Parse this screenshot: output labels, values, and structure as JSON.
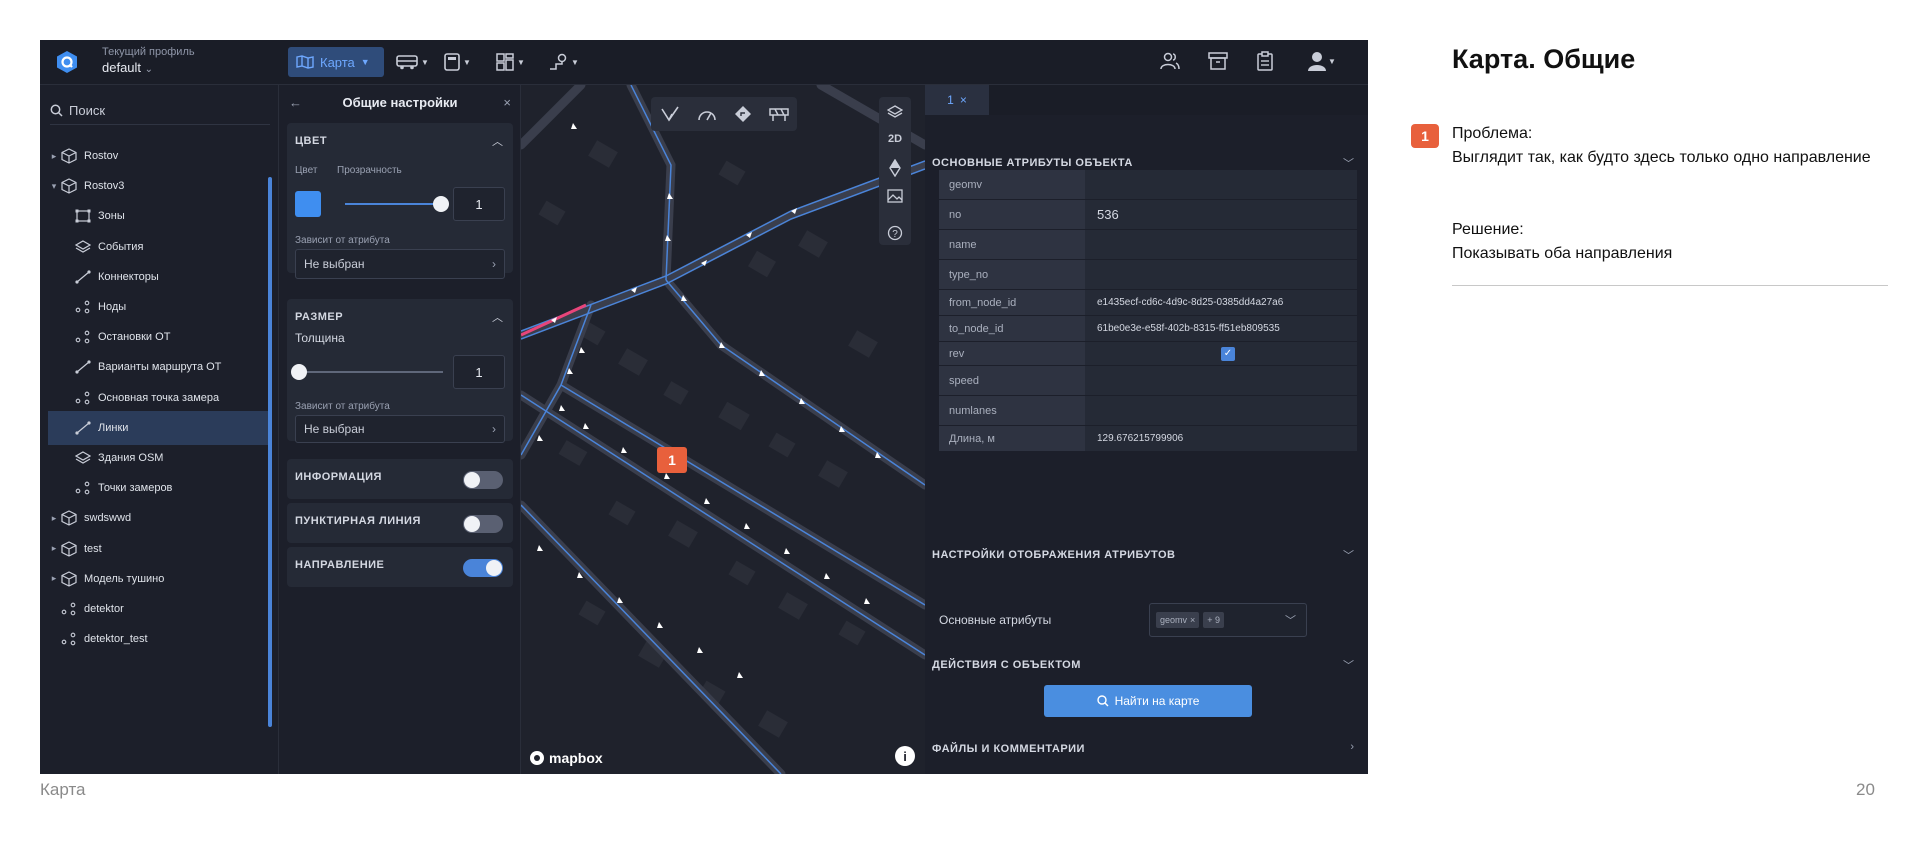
{
  "slide": {
    "title": "Карта. Общие",
    "badge": "1",
    "problem_label": "Проблема:",
    "problem_text": "Выглядит так, как будто здесь только одно направление",
    "solution_label": "Решение:",
    "solution_text": "Показывать оба направления",
    "footer_left": "Карта",
    "page_number": "20"
  },
  "topbar": {
    "profile_caption": "Текущий профиль",
    "profile_value": "default",
    "map_button": "Карта"
  },
  "sidebar": {
    "search_placeholder": "Поиск",
    "items": [
      {
        "label": "Rostov",
        "caret": "▸",
        "icon": "cube-icon"
      },
      {
        "label": "Rostov3",
        "caret": "▾",
        "icon": "cube-icon"
      },
      {
        "label": "Зоны",
        "icon": "zone-icon"
      },
      {
        "label": "События",
        "icon": "layers-icon"
      },
      {
        "label": "Коннекторы",
        "icon": "link-icon"
      },
      {
        "label": "Ноды",
        "icon": "nodes-icon"
      },
      {
        "label": "Остановки ОТ",
        "icon": "nodes-icon"
      },
      {
        "label": "Варианты маршрута ОТ",
        "icon": "link-icon"
      },
      {
        "label": "Основная точка замера",
        "icon": "nodes-icon"
      },
      {
        "label": "Линки",
        "icon": "link-icon",
        "active": true
      },
      {
        "label": "Здания OSM",
        "icon": "layers-icon"
      },
      {
        "label": "Точки замеров",
        "icon": "nodes-icon"
      },
      {
        "label": "swdswwd",
        "caret": "▸",
        "icon": "cube-icon"
      },
      {
        "label": "test",
        "caret": "▸",
        "icon": "cube-icon"
      },
      {
        "label": "Модель тушино",
        "caret": "▸",
        "icon": "cube-icon"
      },
      {
        "label": "detektor",
        "icon": "nodes-icon"
      },
      {
        "label": "detektor_test",
        "icon": "nodes-icon"
      }
    ]
  },
  "settings": {
    "title": "Общие настройки",
    "color_section": "ЦВЕТ",
    "color_label": "Цвет",
    "opacity_label": "Прозрачность",
    "opacity_value": "1",
    "depends_label": "Зависит от атрибута",
    "not_selected": "Не выбран",
    "size_section": "РАЗМЕР",
    "thickness_label": "Толщина",
    "thickness_value": "1",
    "info_section": "ИНФОРМАЦИЯ",
    "dashed_section": "ПУНКТИРНАЯ ЛИНИЯ",
    "direction_section": "НАПРАВЛЕНИЕ",
    "info_on": false,
    "dashed_on": false,
    "direction_on": true,
    "accent_color": "#3f8ef0"
  },
  "map": {
    "view_mode": "2D",
    "attribution": "mapbox",
    "marker": "1"
  },
  "attrs": {
    "tab_label": "1",
    "main_section": "ОСНОВНЫЕ АТРИБУТЫ ОБЪЕКТА",
    "rows": [
      {
        "key": "geomv",
        "value": ""
      },
      {
        "key": "no",
        "value": "536"
      },
      {
        "key": "name",
        "value": ""
      },
      {
        "key": "type_no",
        "value": ""
      },
      {
        "key": "from_node_id",
        "value": "e1435ecf-cd6c-4d9c-8d25-0385dd4a27a6"
      },
      {
        "key": "to_node_id",
        "value": "61be0e3e-e58f-402b-8315-ff51eb809535"
      },
      {
        "key": "rev",
        "value": "",
        "checkbox": true
      },
      {
        "key": "speed",
        "value": ""
      },
      {
        "key": "numlanes",
        "value": ""
      },
      {
        "key": "Длина, м",
        "value": "129.676215799906"
      }
    ],
    "display_section": "НАСТРОЙКИ ОТОБРАЖЕНИЯ АТРИБУТОВ",
    "display_label": "Основные атрибуты",
    "chip_1": "geomv",
    "chip_2": "+ 9",
    "actions_section": "ДЕЙСТВИЯ С ОБЪЕКТОМ",
    "find_button": "Найти на карте",
    "files_section": "ФАЙЛЫ И КОММЕНТАРИИ"
  }
}
